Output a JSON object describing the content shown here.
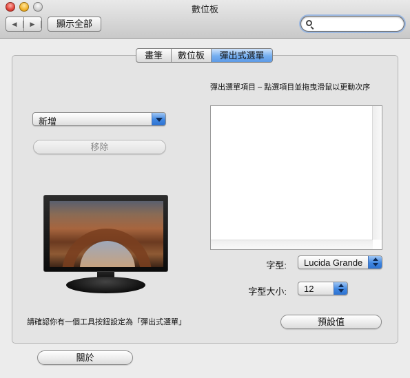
{
  "window": {
    "title": "數位板",
    "nav_back_glyph": "◀",
    "nav_forward_glyph": "▶",
    "show_all_label": "顯示全部",
    "search": {
      "value": "",
      "placeholder": ""
    }
  },
  "tabs": [
    {
      "label": "畫筆",
      "selected": false
    },
    {
      "label": "數位板",
      "selected": false
    },
    {
      "label": "彈出式選單",
      "selected": true
    }
  ],
  "popup_menu_panel": {
    "caption": "彈出選單項目 – 點選項目並拖曳滑鼠以更動次序",
    "add_popup": {
      "selected": "新增"
    },
    "remove_button": {
      "label": "移除",
      "enabled": false
    },
    "menu_items": [],
    "font_label": "字型:",
    "font_popup": {
      "selected": "Lucida Grande"
    },
    "font_size_label": "字型大小:",
    "font_size_popup": {
      "selected": "12"
    },
    "defaults_button": {
      "label": "預設值"
    },
    "note": "請確認你有一個工具按鈕設定為「彈出式選單」"
  },
  "about_button": {
    "label": "關於"
  },
  "icons": {
    "traffic_lights": [
      "close-icon",
      "minimize-icon",
      "zoom-icon"
    ],
    "search": "search-icon",
    "illustration": "monitor-icon"
  },
  "colors": {
    "accent": "#3f86e0",
    "window_bg": "#ececec"
  }
}
